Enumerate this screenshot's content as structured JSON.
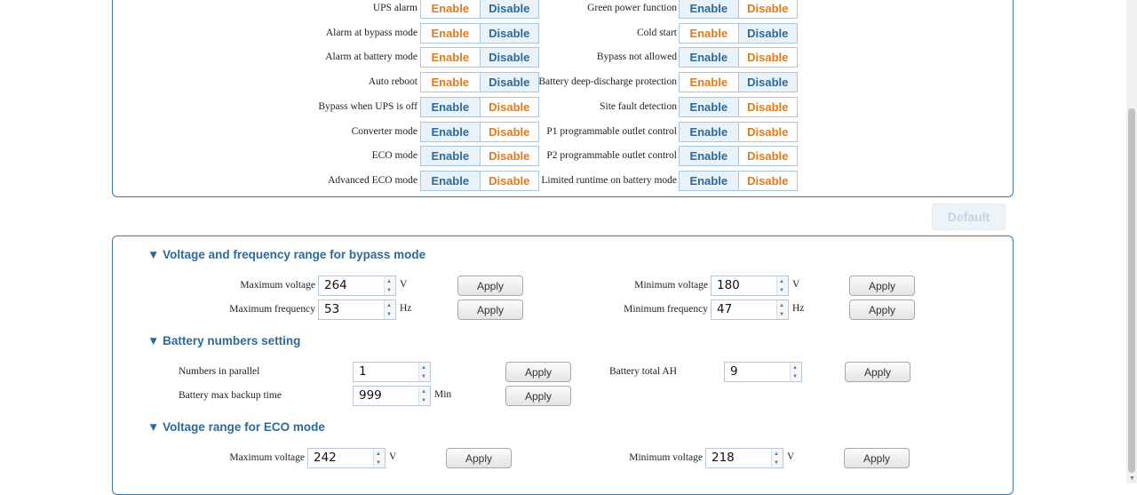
{
  "toggles": {
    "enable_label": "Enable",
    "disable_label": "Disable",
    "left": [
      {
        "label": "UPS alarm",
        "state": "enable"
      },
      {
        "label": "Alarm at bypass mode",
        "state": "enable"
      },
      {
        "label": "Alarm at battery mode",
        "state": "enable"
      },
      {
        "label": "Auto reboot",
        "state": "enable"
      },
      {
        "label": "Bypass when UPS is off",
        "state": "disable"
      },
      {
        "label": "Converter mode",
        "state": "disable"
      },
      {
        "label": "ECO mode",
        "state": "disable"
      },
      {
        "label": "Advanced ECO mode",
        "state": "disable"
      }
    ],
    "right": [
      {
        "label": "Green power function",
        "state": "disable"
      },
      {
        "label": "Cold start",
        "state": "enable"
      },
      {
        "label": "Bypass not allowed",
        "state": "disable"
      },
      {
        "label": "Battery deep-discharge protection",
        "state": "enable"
      },
      {
        "label": "Site fault detection",
        "state": "disable"
      },
      {
        "label": "P1 programmable outlet control",
        "state": "disable"
      },
      {
        "label": "P2 programmable outlet control",
        "state": "disable"
      },
      {
        "label": "Limited runtime on battery mode",
        "state": "disable"
      }
    ]
  },
  "default_button": "Default",
  "apply_label": "Apply",
  "sections": {
    "bypass": {
      "title": "▼ Voltage and frequency range for bypass mode",
      "max_voltage": {
        "label": "Maximum voltage",
        "value": "264",
        "unit": "V"
      },
      "max_frequency": {
        "label": "Maximum frequency",
        "value": "53",
        "unit": "Hz"
      },
      "min_voltage": {
        "label": "Minimum voltage",
        "value": "180",
        "unit": "V"
      },
      "min_frequency": {
        "label": "Minimum frequency",
        "value": "47",
        "unit": "Hz"
      }
    },
    "battery": {
      "title": "▼ Battery numbers setting",
      "parallel": {
        "label": "Numbers in parallel",
        "value": "1"
      },
      "backup": {
        "label": "Battery max backup time",
        "value": "999",
        "unit": "Min"
      },
      "total_ah": {
        "label": "Battery total AH",
        "value": "9"
      }
    },
    "eco": {
      "title": "▼ Voltage range for ECO mode",
      "max_voltage": {
        "label": "Maximum voltage",
        "value": "242",
        "unit": "V"
      },
      "min_voltage": {
        "label": "Minimum voltage",
        "value": "218",
        "unit": "V"
      }
    }
  },
  "colors": {
    "accent": "#2d6a99",
    "disable_text": "#e07a1c",
    "border": "#3b78a6"
  }
}
